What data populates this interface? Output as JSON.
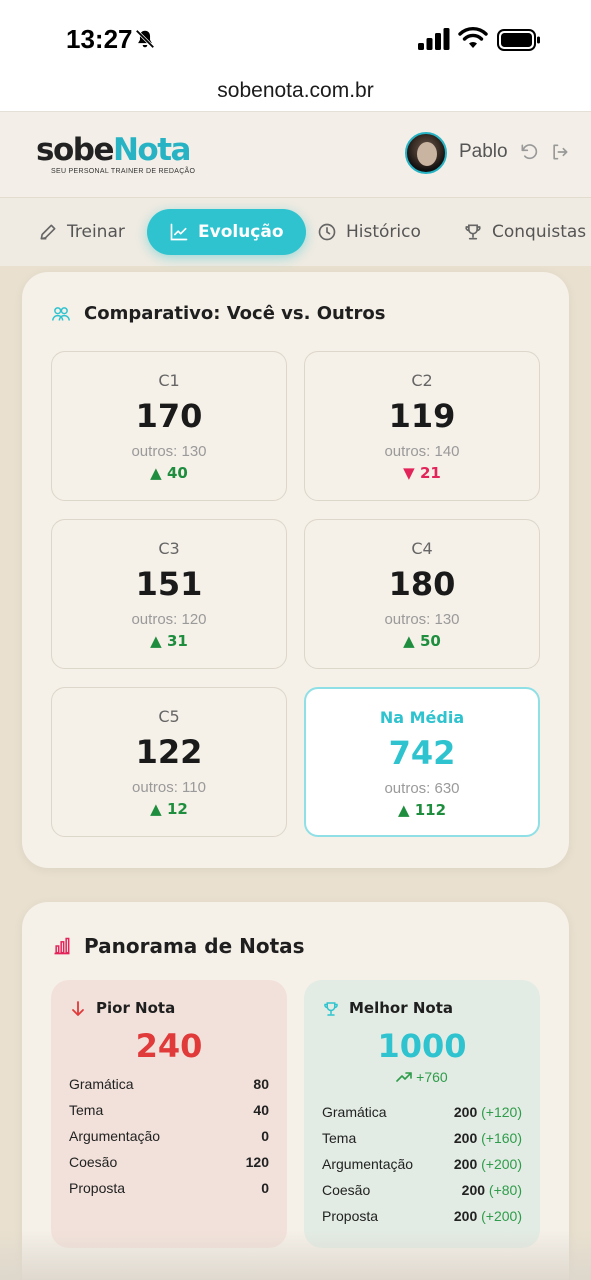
{
  "status_bar": {
    "time": "13:27"
  },
  "url_bar": {
    "url": "sobenota.com.br"
  },
  "header": {
    "logo_main": "sobe",
    "logo_accent": "Nota",
    "logo_tagline": "SEU PERSONAL TRAINER DE REDAÇÃO",
    "user_name": "Pablo"
  },
  "nav": {
    "tabs": [
      {
        "label": "Treinar",
        "icon": "pencil-icon",
        "active": false
      },
      {
        "label": "Evolução",
        "icon": "trend-chart-icon",
        "active": true
      },
      {
        "label": "Histórico",
        "icon": "clock-icon",
        "active": false
      },
      {
        "label": "Conquistas",
        "icon": "trophy-icon",
        "active": false
      }
    ]
  },
  "comparativo": {
    "title": "Comparativo: Você vs. Outros",
    "icon": "users-icon",
    "metrics": [
      {
        "label": "C1",
        "value": "170",
        "others": "outros: 130",
        "diff": "40",
        "direction": "up"
      },
      {
        "label": "C2",
        "value": "119",
        "others": "outros: 140",
        "diff": "21",
        "direction": "down"
      },
      {
        "label": "C3",
        "value": "151",
        "others": "outros: 120",
        "diff": "31",
        "direction": "up"
      },
      {
        "label": "C4",
        "value": "180",
        "others": "outros: 130",
        "diff": "50",
        "direction": "up"
      },
      {
        "label": "C5",
        "value": "122",
        "others": "outros: 110",
        "diff": "12",
        "direction": "up"
      },
      {
        "label": "Na Média",
        "value": "742",
        "others": "outros: 630",
        "diff": "112",
        "direction": "up"
      }
    ]
  },
  "panorama": {
    "title": "Panorama de Notas",
    "icon": "bar-chart-icon",
    "worst": {
      "label": "Pior Nota",
      "score": "240",
      "rows": [
        {
          "label": "Gramática",
          "value": "80"
        },
        {
          "label": "Tema",
          "value": "40"
        },
        {
          "label": "Argumentação",
          "value": "0"
        },
        {
          "label": "Coesão",
          "value": "120"
        },
        {
          "label": "Proposta",
          "value": "0"
        }
      ]
    },
    "best": {
      "label": "Melhor Nota",
      "score": "1000",
      "improvement": "+760",
      "rows": [
        {
          "label": "Gramática",
          "value": "200",
          "gain": "(+120)"
        },
        {
          "label": "Tema",
          "value": "200",
          "gain": "(+160)"
        },
        {
          "label": "Argumentação",
          "value": "200",
          "gain": "(+200)"
        },
        {
          "label": "Coesão",
          "value": "200",
          "gain": "(+80)"
        },
        {
          "label": "Proposta",
          "value": "200",
          "gain": "(+200)"
        }
      ]
    }
  },
  "colors": {
    "accent": "#2ec3cf",
    "up": "#1e8e3e",
    "down": "#e2245a",
    "worst_score": "#e03a3a",
    "background": "#e9e0cf"
  }
}
